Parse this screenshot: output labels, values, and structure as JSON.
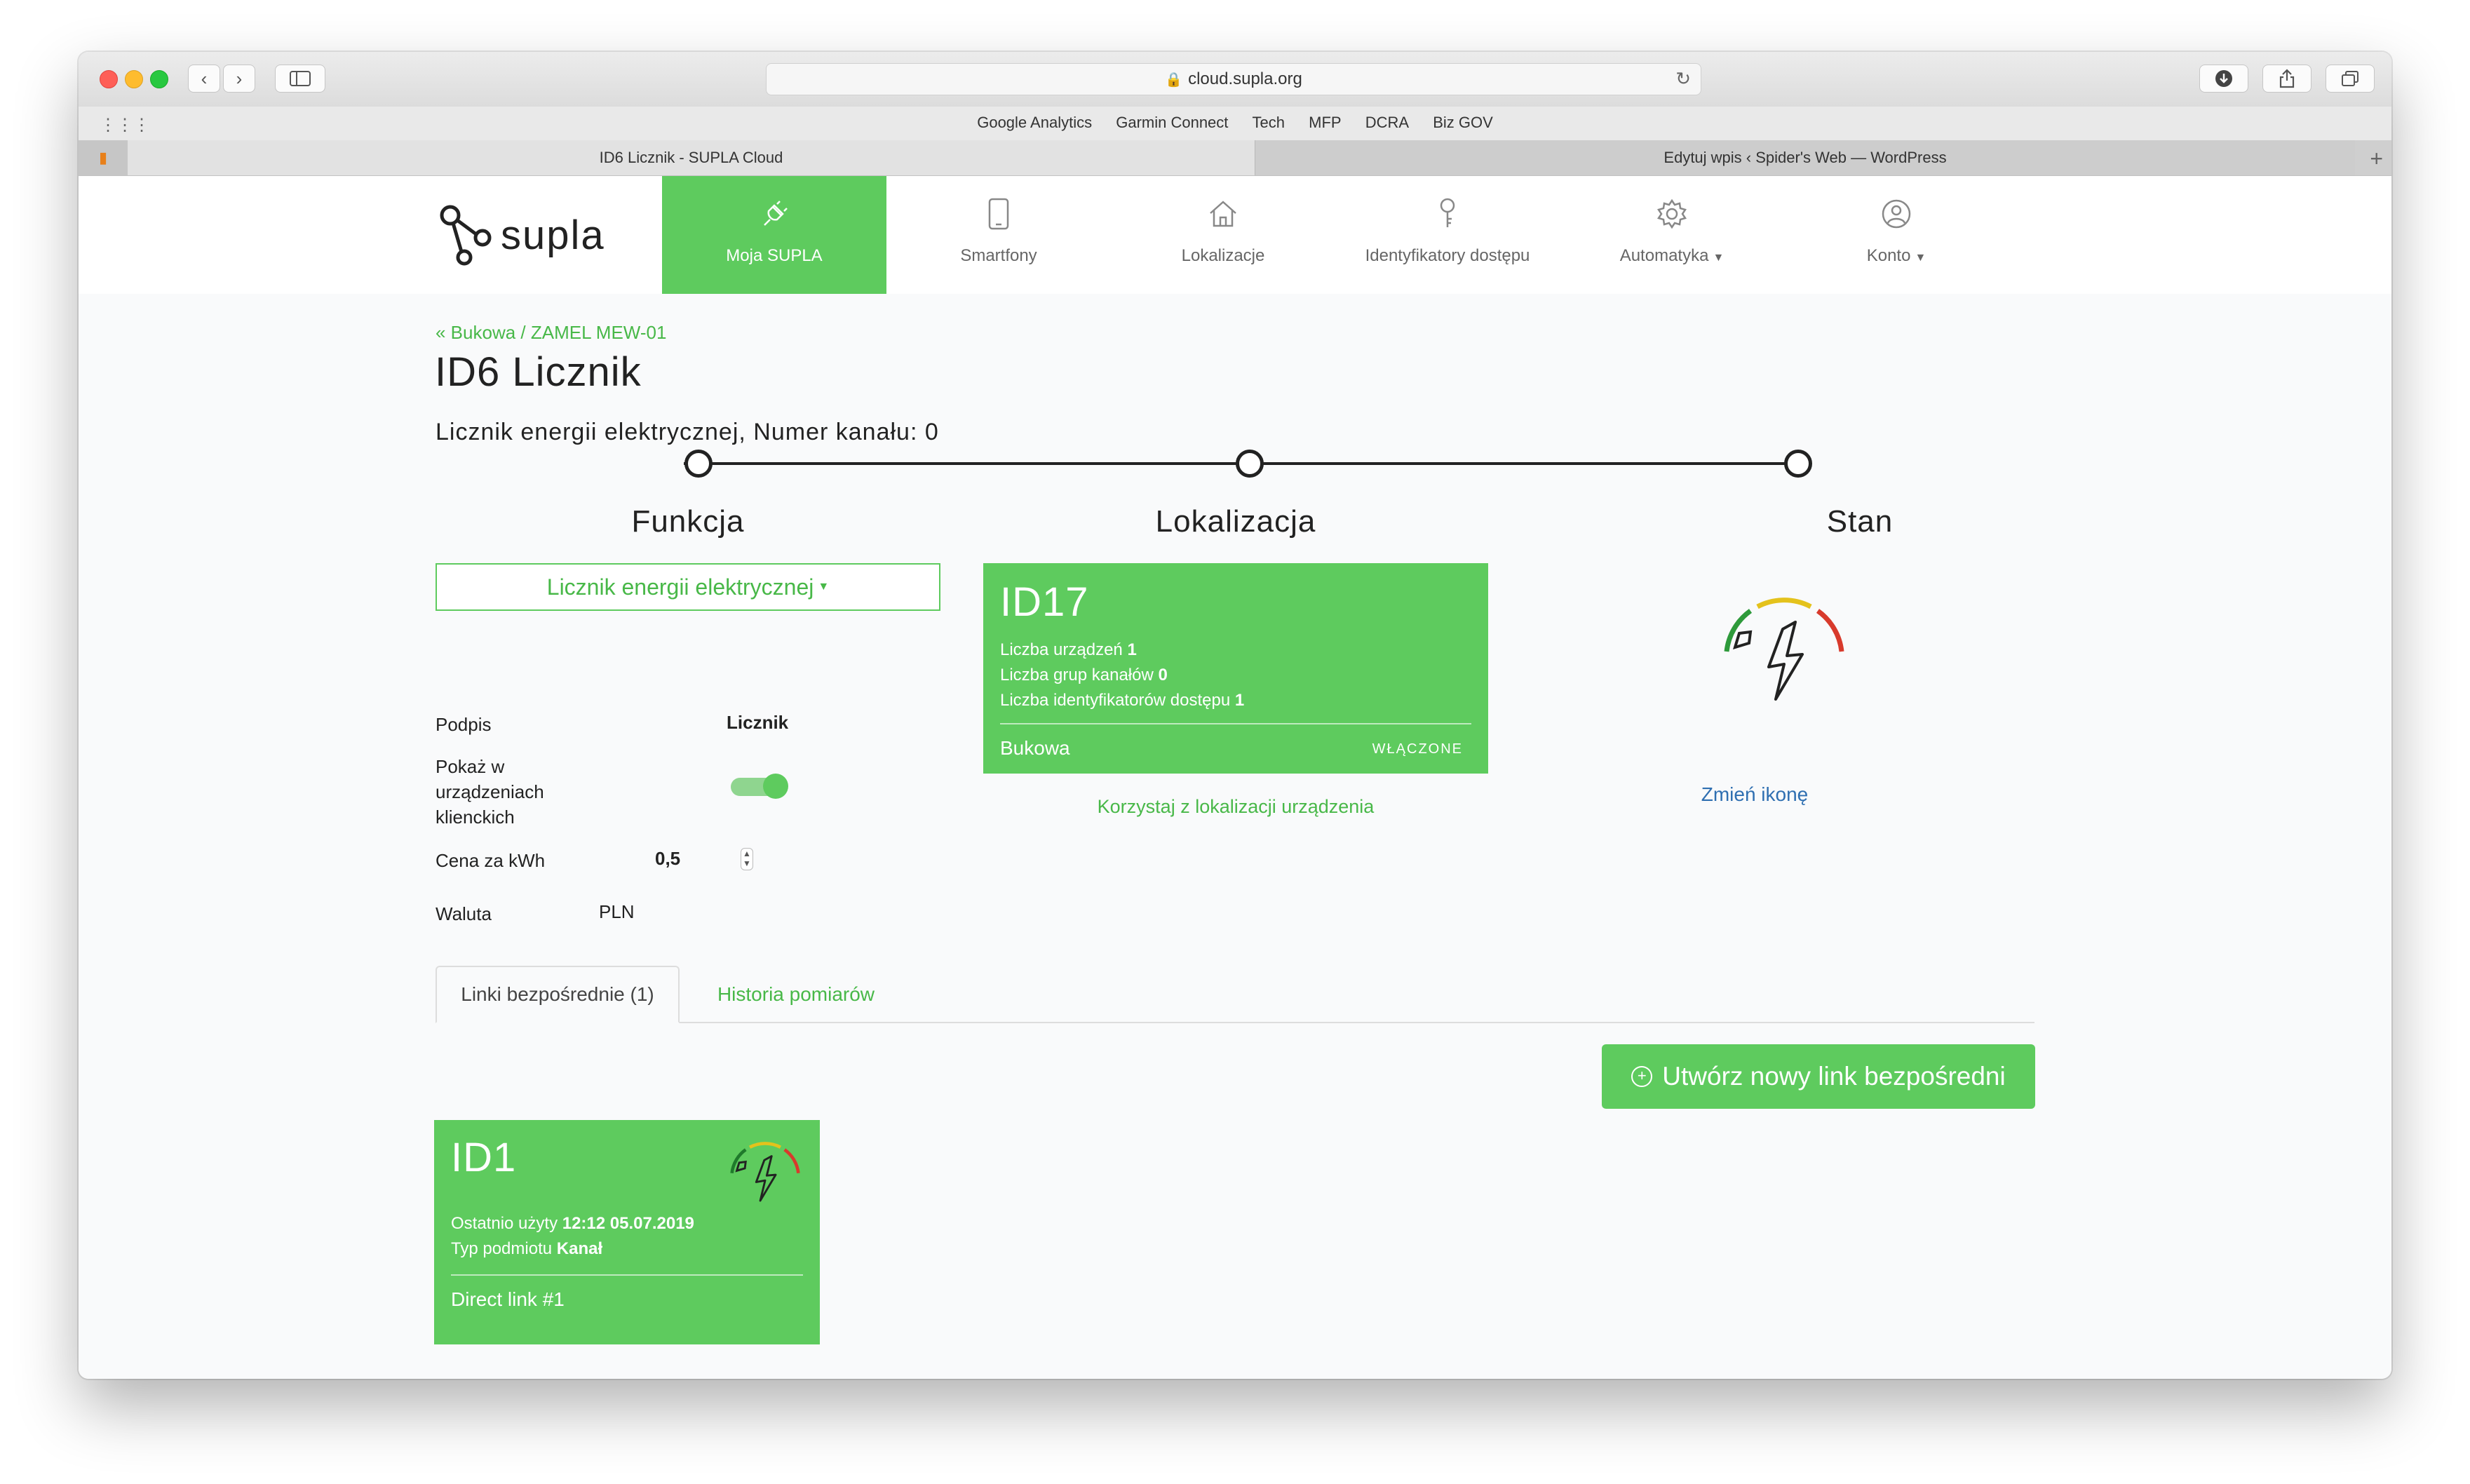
{
  "browser": {
    "url": "cloud.supla.org",
    "favorites": [
      "Google Analytics",
      "Garmin Connect",
      "Tech",
      "MFP",
      "DCRA",
      "Biz GOV"
    ],
    "tabs": [
      {
        "title": "ID6 Licznik - SUPLA Cloud",
        "active": true
      },
      {
        "title": "Edytuj wpis ‹ Spider's Web — WordPress",
        "active": false
      }
    ]
  },
  "nav": {
    "logo": "supla",
    "items": [
      {
        "label": "Moja SUPLA",
        "icon": "plug-icon",
        "active": true
      },
      {
        "label": "Smartfony",
        "icon": "smartphone-icon"
      },
      {
        "label": "Lokalizacje",
        "icon": "home-icon"
      },
      {
        "label": "Identyfikatory dostępu",
        "icon": "key-icon"
      },
      {
        "label": "Automatyka",
        "icon": "gear-icon",
        "dropdown": true
      },
      {
        "label": "Konto",
        "icon": "user-icon",
        "dropdown": true
      }
    ]
  },
  "page": {
    "breadcrumb": "« Bukowa / ZAMEL MEW-01",
    "title": "ID6 Licznik",
    "subtitle": "Licznik energii elektrycznej, Numer kanału: 0"
  },
  "function": {
    "heading": "Funkcja",
    "selected": "Licznik energii elektrycznej",
    "fields": {
      "caption_label": "Podpis",
      "caption_value": "Licznik",
      "show_label": "Pokaż w urządzeniach klienckich",
      "show_value": true,
      "price_label": "Cena za kWh",
      "price_value": "0,5",
      "currency_label": "Waluta",
      "currency_value": "PLN"
    }
  },
  "location": {
    "heading": "Lokalizacja",
    "id": "ID17",
    "devices_label": "Liczba urządzeń",
    "devices_value": "1",
    "groups_label": "Liczba grup kanałów",
    "groups_value": "0",
    "aids_label": "Liczba identyfikatorów dostępu",
    "aids_value": "1",
    "name": "Bukowa",
    "status": "WŁĄCZONE",
    "use_device_location": "Korzystaj z lokalizacji urządzenia"
  },
  "state": {
    "heading": "Stan",
    "icon": "electricity-meter-icon",
    "change_icon": "Zmień ikonę"
  },
  "tabs": [
    {
      "label": "Linki bezpośrednie (1)",
      "active": true
    },
    {
      "label": "Historia pomiarów",
      "active": false
    }
  ],
  "create_link_button": "Utwórz nowy link bezpośredni",
  "direct_link": {
    "id": "ID1",
    "last_used_label": "Ostatnio użyty",
    "last_used_value": "12:12 05.07.2019",
    "subject_type_label": "Typ podmiotu",
    "subject_type_value": "Kanał",
    "name": "Direct link #1"
  },
  "colors": {
    "accent": "#5ecb5e",
    "accent_text": "#48b848",
    "link_blue": "#2f6fb1"
  }
}
